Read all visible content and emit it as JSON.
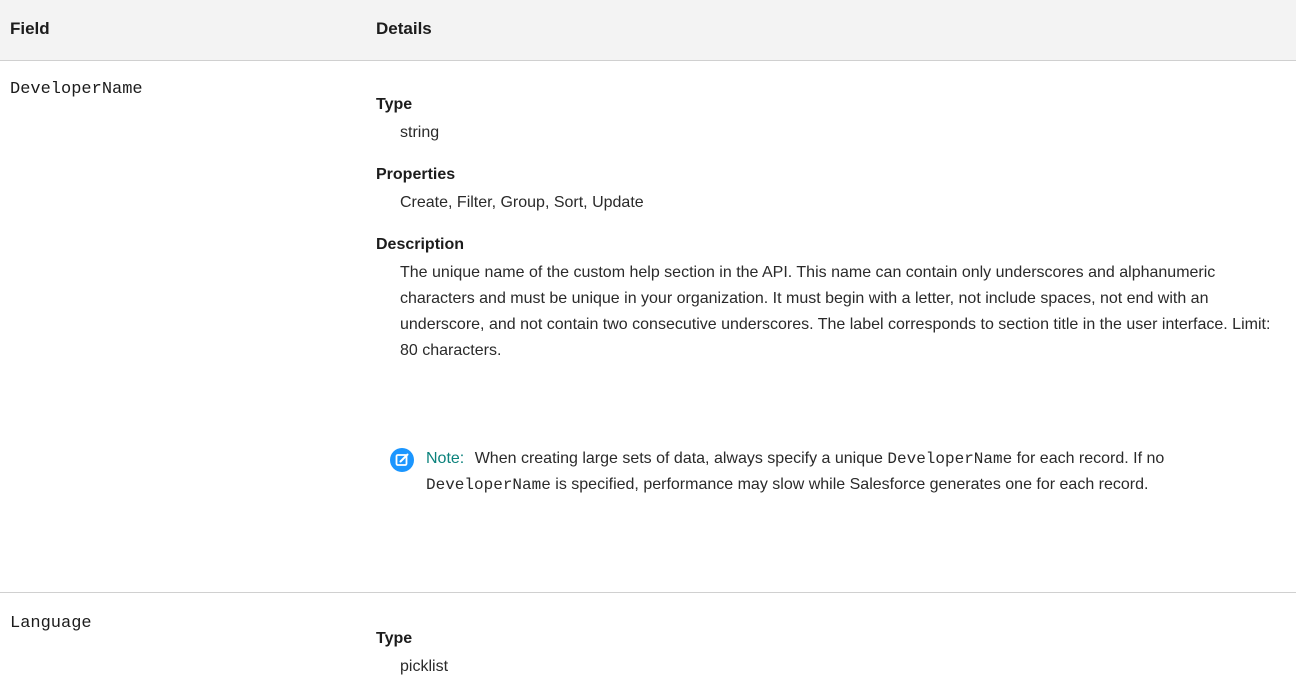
{
  "table": {
    "headers": {
      "field": "Field",
      "details": "Details"
    },
    "rows": [
      {
        "field": "DeveloperName",
        "type_label": "Type",
        "type_value": "string",
        "properties_label": "Properties",
        "properties_value": "Create, Filter, Group, Sort, Update",
        "description_label": "Description",
        "description_value": "The unique name of the custom help section in the API. This name can contain only underscores and alphanumeric characters and must be unique in your organization. It must begin with a letter, not include spaces, not end with an underscore, and not contain two consecutive underscores. The label corresponds to section title in the user interface. Limit: 80 characters.",
        "note": {
          "icon": "edit-note-icon",
          "label": "Note:",
          "text_1": "When creating large sets of data, always specify a unique",
          "code_1": "DeveloperName",
          "text_2": "for each record. If no",
          "code_2": "DeveloperName",
          "text_3": "is specified, performance may slow while Salesforce generates one for each record."
        }
      },
      {
        "field": "Language",
        "type_label": "Type",
        "type_value": "picklist"
      }
    ]
  },
  "colors": {
    "header_bg": "#f3f3f3",
    "divider": "#d0d0d0",
    "note_icon": "#1b96ff",
    "note_label": "#0b827c"
  }
}
